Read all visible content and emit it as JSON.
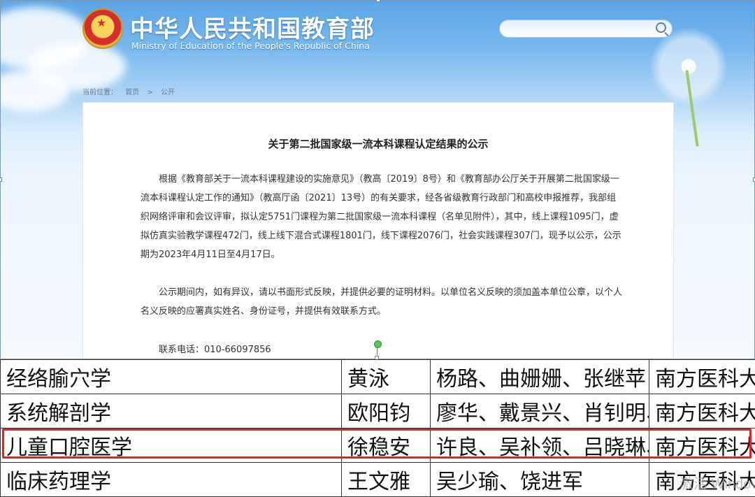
{
  "site": {
    "title": "中华人民共和国教育部",
    "subtitle": "Ministry of Education of the People's Republic of China",
    "search": {
      "placeholder": ""
    }
  },
  "breadcrumb": {
    "label": "当前位置：",
    "items": [
      "首页",
      ">",
      "公开"
    ]
  },
  "document": {
    "title": "关于第二批国家级一流本科课程认定结果的公示",
    "paragraph1": "根据《教育部关于一流本科课程建设的实施意见》（教高〔2019〕8号）和《教育部办公厅关于开展第二批国家级一流本科课程认定工作的通知》（教高厅函〔2021〕13号）的有关要求，经各省级教育行政部门和高校申报推荐，我部组织网络评审和会议评审，拟认定5751门课程为第二批国家级一流本科课程（名单见附件），其中，线上课程1095门，虚拟仿真实验教学课程472门，线上线下混合式课程1801门，线下课程2076门，社会实践课程307门，现予以公示，公示期为2023年4月11日至4月17日。",
    "paragraph2": "公示期间内，如有异议，请以书面形式反映，并提供必要的证明材料。以单位名义反映的须加盖本单位公章，以个人名义反映的应署真实姓名、身份证号，并提供有效联系方式。",
    "contact": "联系电话：010-66097856"
  },
  "table": {
    "rows": [
      {
        "course": "经络腧穴学",
        "leader": "黄泳",
        "members": "杨路、曲姗姗、张继苹",
        "university": "南方医科大学"
      },
      {
        "course": "系统解剖学",
        "leader": "欧阳钧",
        "members": "廖华、戴景兴、肖钊明、钟世镇",
        "university": "南方医科大学"
      },
      {
        "course": "儿童口腔医学",
        "leader": "徐稳安",
        "members": "许良、吴补领、吕晓琳、钟慧",
        "university": "南方医科大学"
      },
      {
        "course": "临床药理学",
        "leader": "王文雅",
        "members": "吴少瑜、饶进军",
        "university": "南方医科大学"
      }
    ],
    "highlighted_row": 2
  },
  "watermark": "激活 Windov"
}
